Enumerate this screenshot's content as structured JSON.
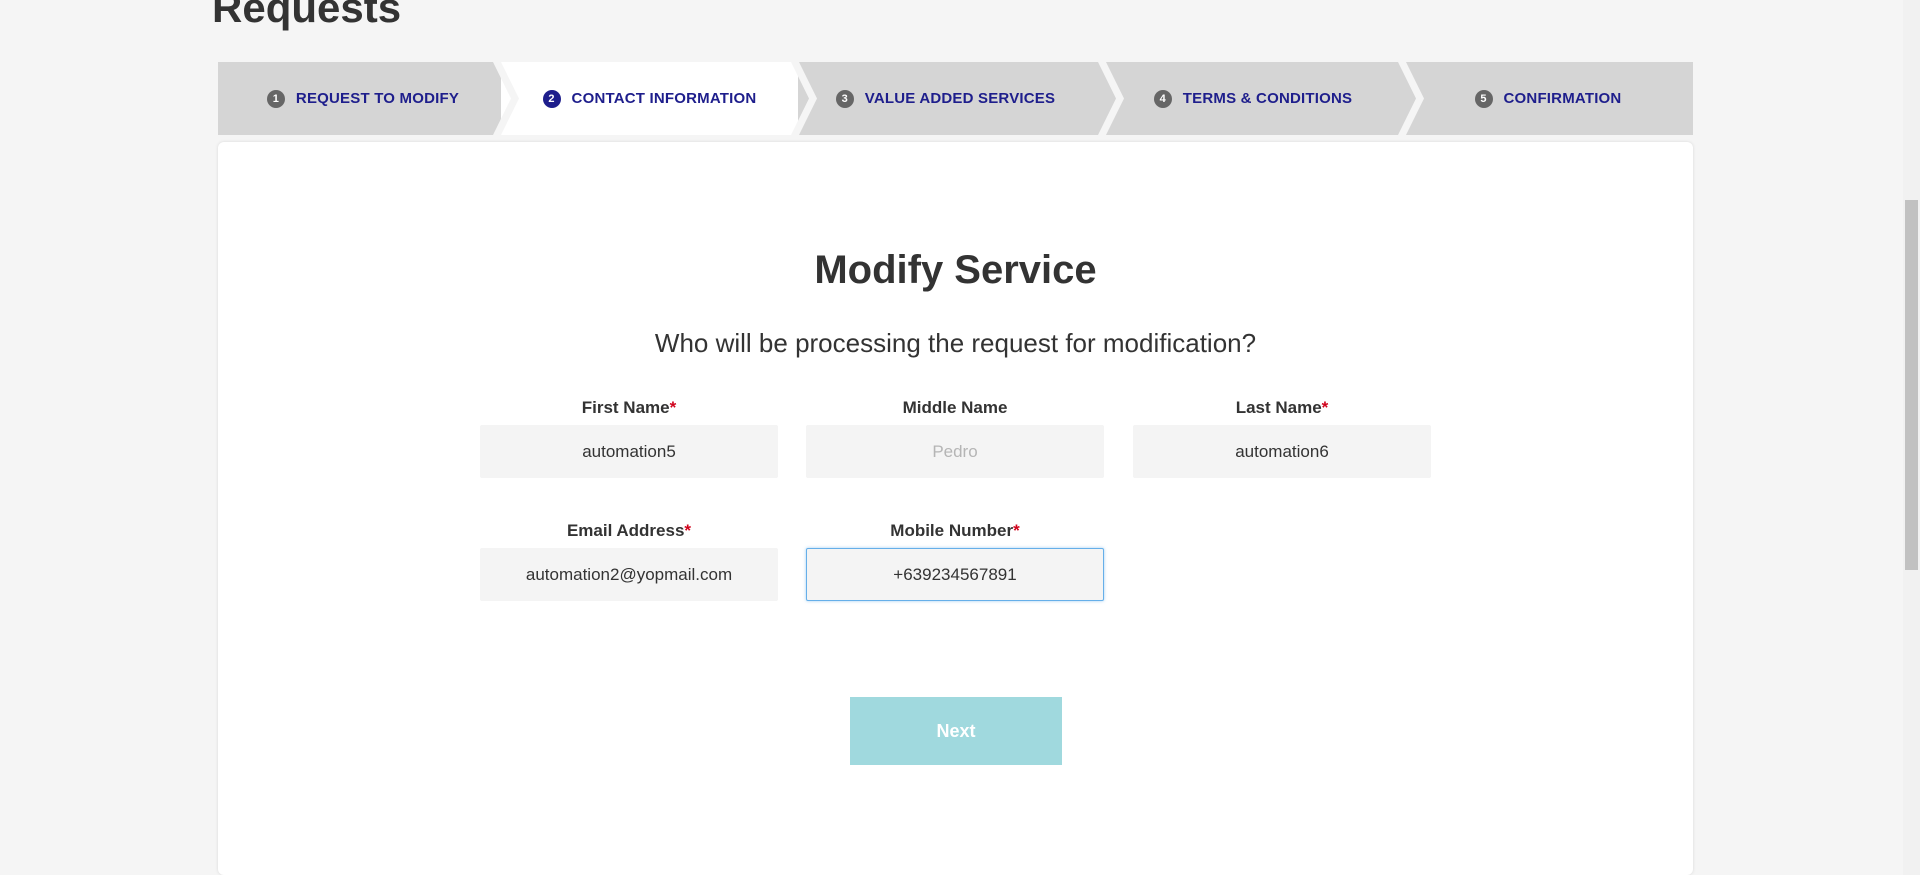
{
  "page": {
    "title": "Requests"
  },
  "stepper": {
    "steps": [
      {
        "num": "1",
        "label": "REQUEST TO MODIFY"
      },
      {
        "num": "2",
        "label": "CONTACT INFORMATION"
      },
      {
        "num": "3",
        "label": "VALUE ADDED SERVICES"
      },
      {
        "num": "4",
        "label": "TERMS & CONDITIONS"
      },
      {
        "num": "5",
        "label": "CONFIRMATION"
      }
    ],
    "active_step": "2"
  },
  "form": {
    "title": "Modify Service",
    "subtitle": "Who will be processing the request for modification?",
    "required_marker": "*",
    "fields": {
      "first_name": {
        "label": "First Name",
        "value": "automation5",
        "required": true
      },
      "middle_name": {
        "label": "Middle Name",
        "value": "",
        "placeholder": "Pedro",
        "required": false
      },
      "last_name": {
        "label": "Last Name",
        "value": "automation6",
        "required": true
      },
      "email": {
        "label": "Email Address",
        "value": "automation2@yopmail.com",
        "required": true
      },
      "mobile": {
        "label": "Mobile Number",
        "value": "+639234567891",
        "required": true
      }
    },
    "next_label": "Next"
  },
  "colors": {
    "accent": "#1e1e8c",
    "required": "#d0021b",
    "next_button": "#a0d9de",
    "stepper_bg": "#d5d5d5"
  }
}
